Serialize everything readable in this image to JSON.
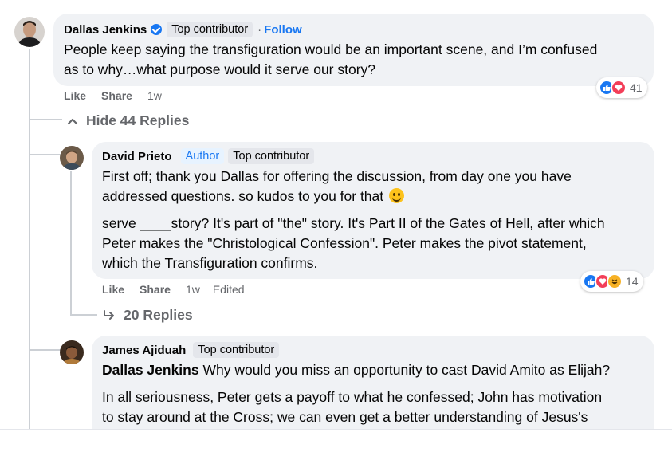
{
  "top_comment": {
    "author": "Dallas Jenkins",
    "badge": "Top contributor",
    "separator": "·",
    "follow_label": "Follow",
    "text_lines": [
      "People keep saying the transfiguration would be an important scene, and I’m confused",
      "as to why…what purpose would it serve our story?"
    ],
    "like_label": "Like",
    "share_label": "Share",
    "time": "1w",
    "reaction_count": "41",
    "reactions": [
      "like-icon",
      "love-icon"
    ]
  },
  "hide_replies_label": "Hide 44 Replies",
  "reply1": {
    "author": "David Prieto",
    "author_badge": "Author",
    "badge": "Top contributor",
    "paragraph1_lines": [
      "First off; thank you Dallas for offering the discussion, from day one you have",
      "addressed questions. so kudos to you for that"
    ],
    "paragraph2_lines": [
      "serve ____story? It's part of \"the\" story. It's Part II of the Gates of Hell, after which",
      "Peter makes the \"Christological Confession\". Peter makes the pivot statement,",
      "which the Transfiguration confirms."
    ],
    "like_label": "Like",
    "share_label": "Share",
    "time": "1w",
    "edited_label": "Edited",
    "reaction_count": "14",
    "reactions": [
      "like-icon",
      "love-icon",
      "haha-icon"
    ],
    "replies_label": "20 Replies"
  },
  "reply2": {
    "author": "James Ajiduah",
    "badge": "Top contributor",
    "mention": "Dallas Jenkins",
    "line1_rest": " Why would you miss an opportunity to cast David Amito as Elijah?",
    "paragraph2_lines": [
      "In all seriousness, Peter gets a payoff to what he confessed; John has motivation",
      "to stay around at the Cross; we can even get a better understanding of Jesus's"
    ]
  },
  "colors": {
    "link": "#1877f2",
    "bubble": "#f0f2f5",
    "meta": "#65676b",
    "like": "#1877f2",
    "love": "#f33e58",
    "haha": "#f7b125"
  }
}
